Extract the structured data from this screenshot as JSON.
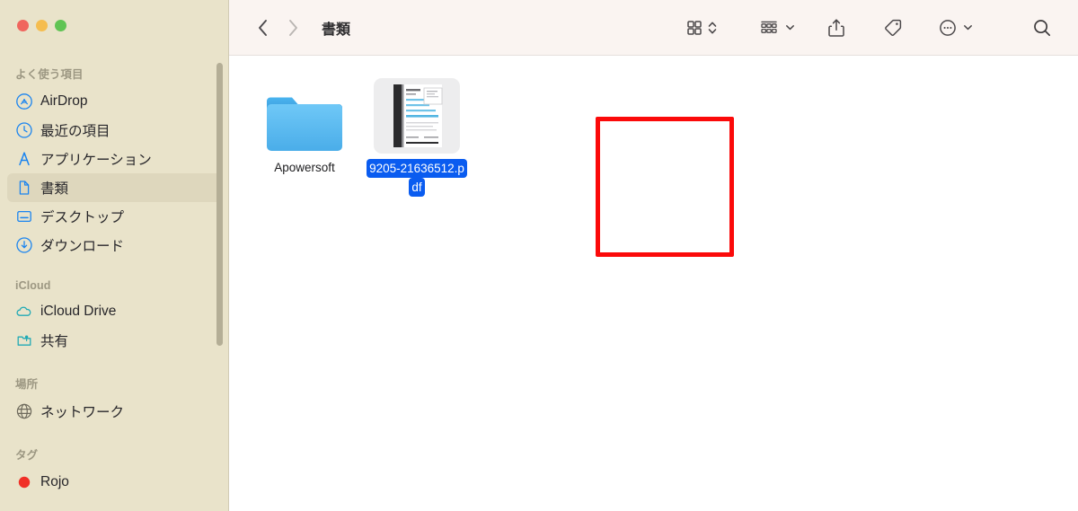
{
  "window": {
    "traffic_lights": [
      {
        "name": "close",
        "color": "#f0665e"
      },
      {
        "name": "minimize",
        "color": "#f5bd4f"
      },
      {
        "name": "maximize",
        "color": "#60c454"
      }
    ]
  },
  "sidebar": {
    "groups": [
      {
        "title": "よく使う項目",
        "items": [
          {
            "label": "AirDrop",
            "icon": "airdrop-icon",
            "color": "#1a84f0",
            "active": false
          },
          {
            "label": "最近の項目",
            "icon": "clock-icon",
            "color": "#1a84f0",
            "active": false
          },
          {
            "label": "アプリケーション",
            "icon": "applications-icon",
            "color": "#1a84f0",
            "active": false
          },
          {
            "label": "書類",
            "icon": "document-icon",
            "color": "#1a84f0",
            "active": true
          },
          {
            "label": "デスクトップ",
            "icon": "desktop-icon",
            "color": "#1a84f0",
            "active": false
          },
          {
            "label": "ダウンロード",
            "icon": "download-icon",
            "color": "#1a84f0",
            "active": false
          }
        ]
      },
      {
        "title": "iCloud",
        "items": [
          {
            "label": "iCloud Drive",
            "icon": "cloud-icon",
            "color": "#22aab5",
            "active": false
          },
          {
            "label": "共有",
            "icon": "shared-folder-icon",
            "color": "#22aab5",
            "active": false
          }
        ]
      },
      {
        "title": "場所",
        "items": [
          {
            "label": "ネットワーク",
            "icon": "globe-icon",
            "color": "#6e6a5c",
            "active": false
          }
        ]
      },
      {
        "title": "タグ",
        "items": [
          {
            "label": "Rojo",
            "icon": "red-dot-icon",
            "color": "#f03027",
            "active": false
          }
        ]
      }
    ]
  },
  "toolbar": {
    "back_label": "戻る",
    "forward_label": "進む",
    "path_title": "書類",
    "buttons": [
      {
        "name": "view-grid-button",
        "label": "表示"
      },
      {
        "name": "group-by-button",
        "label": "グループ分け"
      },
      {
        "name": "share-button",
        "label": "共有"
      },
      {
        "name": "tag-button",
        "label": "タグ"
      },
      {
        "name": "more-actions-button",
        "label": "その他"
      },
      {
        "name": "search-button",
        "label": "検索"
      }
    ]
  },
  "files": [
    {
      "name": "Apowersoft",
      "kind": "folder",
      "selected": false
    },
    {
      "name": "9205-21636512.pdf",
      "kind": "pdf",
      "selected": true,
      "label_line1": "9205-21636512.p",
      "label_line2": "df"
    }
  ],
  "annotation": {
    "shape": "rectangle",
    "color": "#fb0a0a",
    "target": "9205-21636512.pdf"
  },
  "colors": {
    "sidebar_bg": "#e9e3ca",
    "toolbar_bg": "#faf4f1",
    "content_bg": "#ffffff",
    "selection_blue": "#0a5cf0",
    "sidebar_active": "#ded7bd"
  }
}
